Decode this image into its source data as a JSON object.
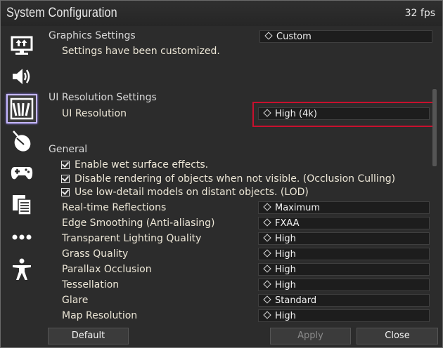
{
  "window": {
    "title": "System Configuration",
    "fps": "32 fps"
  },
  "sidebar": {
    "items": [
      {
        "icon": "display-upload-icon"
      },
      {
        "icon": "speaker-icon"
      },
      {
        "icon": "ui-bars-icon",
        "active": true
      },
      {
        "icon": "mouse-icon"
      },
      {
        "icon": "gamepad-icon"
      },
      {
        "icon": "documents-icon"
      },
      {
        "icon": "more-icon"
      },
      {
        "icon": "accessibility-icon"
      }
    ]
  },
  "graphics": {
    "heading": "Graphics Settings",
    "preset": "Custom",
    "note": "Settings have been customized."
  },
  "ui_resolution": {
    "heading": "UI Resolution Settings",
    "label": "UI Resolution",
    "value": "High (4k)"
  },
  "general": {
    "heading": "General",
    "checks": [
      "Enable wet surface effects.",
      "Disable rendering of objects when not visible. (Occlusion Culling)",
      "Use low-detail models on distant objects. (LOD)"
    ],
    "settings": [
      {
        "label": "Real-time Reflections",
        "value": "Maximum"
      },
      {
        "label": "Edge Smoothing (Anti-aliasing)",
        "value": "FXAA"
      },
      {
        "label": "Transparent Lighting Quality",
        "value": "High"
      },
      {
        "label": "Grass Quality",
        "value": "High"
      },
      {
        "label": "Parallax Occlusion",
        "value": "High"
      },
      {
        "label": "Tessellation",
        "value": "High"
      },
      {
        "label": "Glare",
        "value": "Standard"
      },
      {
        "label": "Map Resolution",
        "value": "High"
      }
    ]
  },
  "footer": {
    "default": "Default",
    "apply": "Apply",
    "close": "Close"
  }
}
